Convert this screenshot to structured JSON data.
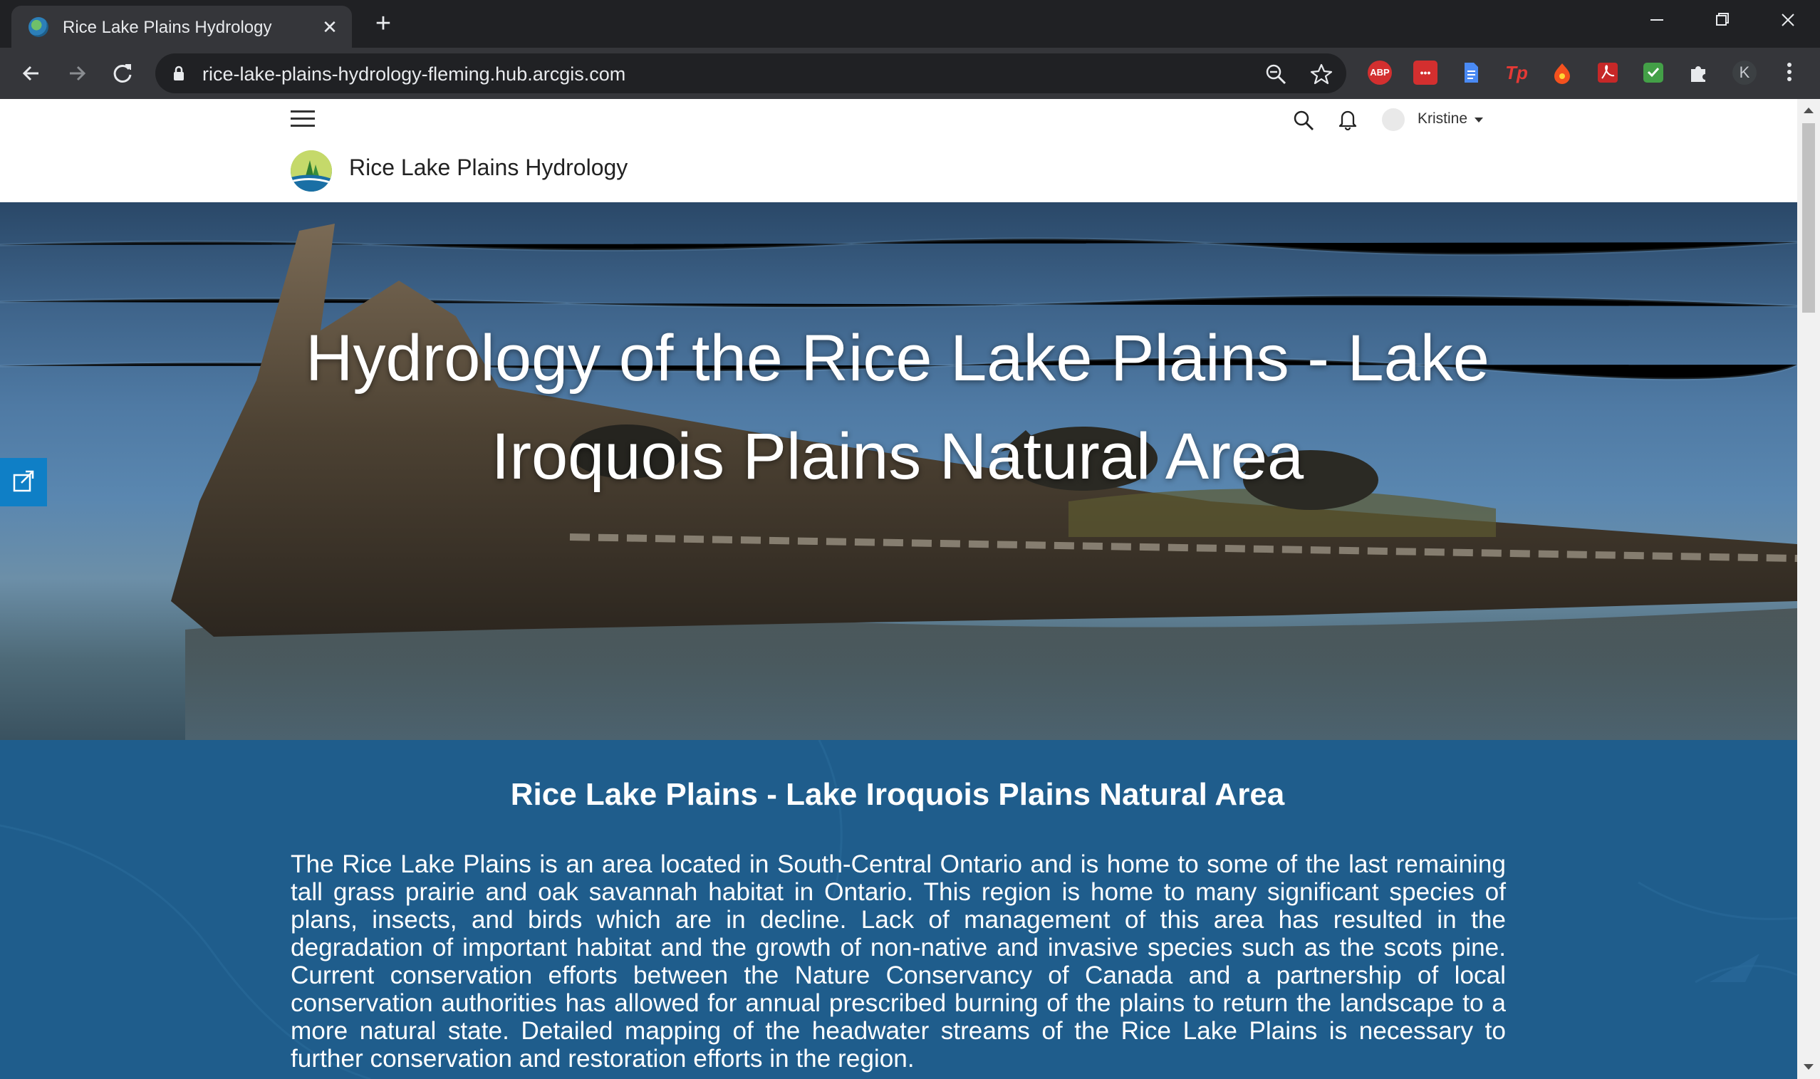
{
  "browser": {
    "tab": {
      "title": "Rice Lake Plains Hydrology",
      "close_glyph": "✕"
    },
    "new_tab_glyph": "+",
    "address": {
      "url": "rice-lake-plains-hydrology-fleming.hub.arcgis.com"
    },
    "extensions": [
      {
        "name": "adblock-plus-extension-icon",
        "label": "ABP",
        "color": "#d32f2f"
      },
      {
        "name": "lastpass-extension-icon",
        "label": "•••",
        "color": "#d32f2f"
      },
      {
        "name": "document-extension-icon",
        "label": "",
        "color": "#4a8af4"
      },
      {
        "name": "tp-extension-icon",
        "label": "Tp",
        "color": "#e53935"
      },
      {
        "name": "honey-extension-icon",
        "label": "",
        "color": "#f4511e"
      },
      {
        "name": "acrobat-extension-icon",
        "label": "",
        "color": "#c62828"
      },
      {
        "name": "green-shield-extension-icon",
        "label": "",
        "color": "#43a047"
      }
    ],
    "profile_initial": "K"
  },
  "site": {
    "title": "Rice Lake Plains Hydrology",
    "user_name": "Kristine"
  },
  "hero": {
    "title": "Hydrology of the Rice Lake Plains - Lake Iroquois Plains Natural Area"
  },
  "intro": {
    "heading": "Rice Lake Plains - Lake Iroquois Plains Natural Area",
    "body": "The Rice Lake Plains is an area located in South-Central Ontario and is home to some of the last remaining tall grass prairie and oak savannah habitat in Ontario. This region is home to many significant species of plans, insects, and birds which are in decline. Lack of management of this area has resulted in the degradation of important habitat and the growth of non-native and invasive species such as the scots pine. Current conservation efforts between the Nature Conservancy of Canada and a partnership of local conservation authorities has allowed for annual prescribed burning of the plains to return the landscape to a more natural state. Detailed mapping of the headwater streams of the Rice Lake Plains is necessary to further conservation and restoration efforts in the region."
  },
  "colors": {
    "chrome_dark": "#202124",
    "chrome_toolbar": "#35363a",
    "intro_band": "#1f5d8c",
    "share_tab": "#0f7fc6"
  }
}
